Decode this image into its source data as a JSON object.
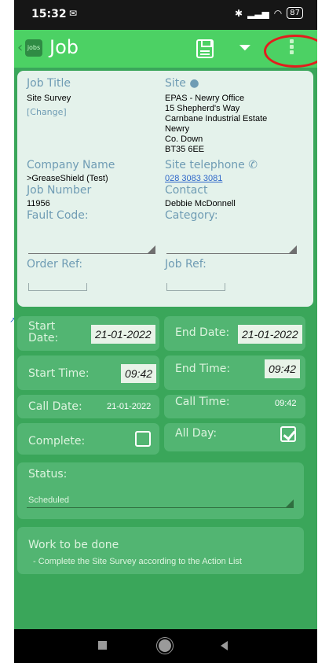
{
  "status_bar": {
    "time": "15:32",
    "battery": "87"
  },
  "app_bar": {
    "logo_text": "jobs",
    "title": "Job"
  },
  "job": {
    "job_title_label": "Job Title",
    "job_title_value": "Site Survey",
    "change_link": "[Change]",
    "site_label": "Site",
    "site_address": [
      "EPAS - Newry Office",
      "15 Shepherd's Way",
      "Carnbane Industrial Estate",
      "Newry",
      "Co. Down",
      "BT35 6EE"
    ],
    "company_name_label": "Company Name",
    "company_name_value": ">GreaseShield (Test)",
    "site_telephone_label": "Site telephone",
    "site_telephone_value": "028 3083 3081",
    "job_number_label": "Job Number",
    "job_number_value": "11956",
    "contact_label": "Contact",
    "contact_value": "Debbie McDonnell",
    "fault_code_label": "Fault Code:",
    "category_label": "Category:",
    "order_ref_label": "Order Ref:",
    "job_ref_label": "Job Ref:"
  },
  "schedule": {
    "start_date_label": "Start Date:",
    "start_date_value": "21-01-2022",
    "end_date_label": "End Date:",
    "end_date_value": "21-01-2022",
    "start_time_label": "Start Time:",
    "start_time_value": "09:42",
    "end_time_label": "End Time:",
    "end_time_value": "09:42",
    "call_date_label": "Call Date:",
    "call_date_value": "21-01-2022",
    "call_time_label": "Call Time:",
    "call_time_value": "09:42",
    "complete_label": "Complete:",
    "complete_checked": false,
    "all_day_label": "All Day:",
    "all_day_checked": true
  },
  "status": {
    "label": "Status:",
    "value": "Scheduled"
  },
  "work": {
    "label": "Work to be done",
    "value": "- Complete the Site Survey according to the Action List"
  },
  "colors": {
    "background": "#3aa65a",
    "app_bar": "#4cd164",
    "card": "#e4f2eb",
    "tile": "#52b572",
    "highlight": "#e31d1d"
  }
}
